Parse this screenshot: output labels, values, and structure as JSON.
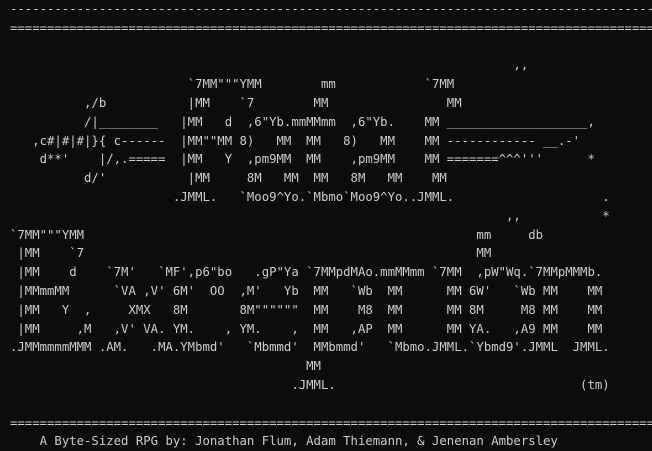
{
  "screen": {
    "top_rules": [
      "--------------------------------------------------------------------------------------------------",
      "=================================================================================================="
    ],
    "logo_lines": [
      "",
      "                                                                    ,,",
      "                        `7MM\"\"\"YMM        mm            `7MM",
      "          ,/b           |MM    `7        MM                MM",
      "          /|________   |MM   d  ,6\"Yb.mmMMmm  ,6\"Yb.    MM ___________________,",
      "   ,c#|#|#|}{ c------  |MM\"\"MM 8)   MM  MM   8)   MM    MM ------------ __.-'",
      "    d**'    |/,.=====  |MM   Y  ,pm9MM  MM    ,pm9MM    MM =======^^^'''      *",
      "          d/'           |MM     8M   MM  MM   8M   MM    MM",
      "                      .JMML.   `Moo9^Yo.`Mbmo`Moo9^Yo..JMML.                    .",
      "                                                                   ,,           *",
      "`7MM\"\"\"YMM                                                     mm     db",
      " |MM    `7                                                     MM",
      " |MM    d    `7M'   `MF',p6\"bo   .gP\"Ya `7MMpdMAo.mmMMmm `7MM  ,pW\"Wq.`7MMpMMMb.",
      " |MMmmMM      `VA ,V' 6M'  OO  ,M'   Yb  MM   `Wb  MM      MM 6W'   `Wb MM    MM",
      " |MM   Y  ,     XMX   8M       8M\"\"\"\"\"\"  MM    M8  MM      MM 8M     M8 MM    MM",
      " |MM     ,M   ,V' VA. YM.    , YM.    ,  MM   ,AP  MM      MM YA.   ,A9 MM    MM",
      ".JMMmmmmMMM .AM.   .MA.YMbmd'   `Mbmmd'  MMbmmd'   `Mbmo.JMML.`Ybmd9'.JMML  JMML.",
      "                                        MM",
      "                                      .JMML.                                 (tm)",
      ""
    ],
    "bottom_rule_top": "==================================================================================================",
    "credit": "    A Byte-Sized RPG by: Jonathan Flum, Adam Thiemann, & Jenenan Ambersley",
    "bottom_rule_bottom": "--------------------------------------------------------------------------------------------------"
  }
}
